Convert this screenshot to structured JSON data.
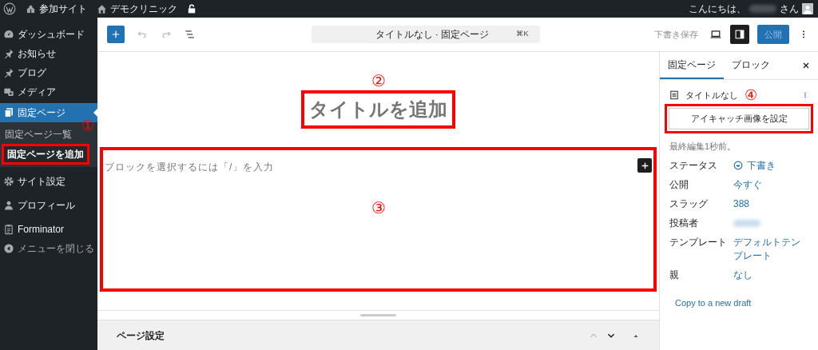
{
  "admin_bar": {
    "items": [
      {
        "kind": "wp"
      },
      {
        "kind": "sites",
        "label": "参加サイト"
      },
      {
        "kind": "home",
        "label": "デモクリニック"
      },
      {
        "kind": "lock"
      }
    ],
    "greeting": "こんにちは、",
    "suffix": "さん"
  },
  "sidebar": {
    "items": [
      {
        "label": "ダッシュボード",
        "selected": false,
        "dim": false
      },
      {
        "label": "お知らせ",
        "selected": false,
        "dim": false
      },
      {
        "label": "ブログ",
        "selected": false,
        "dim": false
      },
      {
        "label": "メディア",
        "selected": false,
        "dim": false
      },
      {
        "label": "固定ページ",
        "selected": true,
        "dim": false,
        "children": [
          {
            "label": "固定ページ一覧",
            "selected": false,
            "highlighted": false,
            "annotation": "①"
          },
          {
            "label": "固定ページを追加",
            "selected": true,
            "highlighted": true
          }
        ]
      },
      {
        "label": "サイト設定",
        "selected": false,
        "dim": false
      },
      {
        "label": "プロフィール",
        "selected": false,
        "dim": false
      },
      {
        "label": "Forminator",
        "selected": false,
        "dim": false
      },
      {
        "label": "メニューを閉じる",
        "selected": false,
        "dim": true
      }
    ]
  },
  "header": {
    "command": "タイトルなし · 固定ページ",
    "shortcut": "⌘K",
    "save_draft": "下書き保存",
    "publish": "公開"
  },
  "canvas": {
    "title_placeholder": "タイトルを追加",
    "title_annotation": "②",
    "block_placeholder": "ブロックを選択するには「/」を入力",
    "block_annotation": "③"
  },
  "meta_box": {
    "title": "ページ設定"
  },
  "inspector": {
    "tabs": [
      {
        "label": "固定ページ",
        "selected": true
      },
      {
        "label": "ブロック",
        "selected": false
      }
    ],
    "page_title": "タイトルなし",
    "featured_button": "アイキャッチ画像を設定",
    "featured_annotation": "④",
    "last_edited": "最終編集1秒前。",
    "rows": [
      {
        "label": "ステータス",
        "value": "下書き",
        "kind": "status"
      },
      {
        "label": "公開",
        "value": "今すぐ",
        "kind": "link"
      },
      {
        "label": "スラッグ",
        "value": "388",
        "kind": "link"
      },
      {
        "label": "投稿者",
        "kind": "redacted"
      },
      {
        "label": "テンプレート",
        "value": "デフォルトテンプレート",
        "kind": "link"
      },
      {
        "label": "親",
        "value": "なし",
        "kind": "link"
      }
    ],
    "copy_link": "Copy to a new draft"
  }
}
